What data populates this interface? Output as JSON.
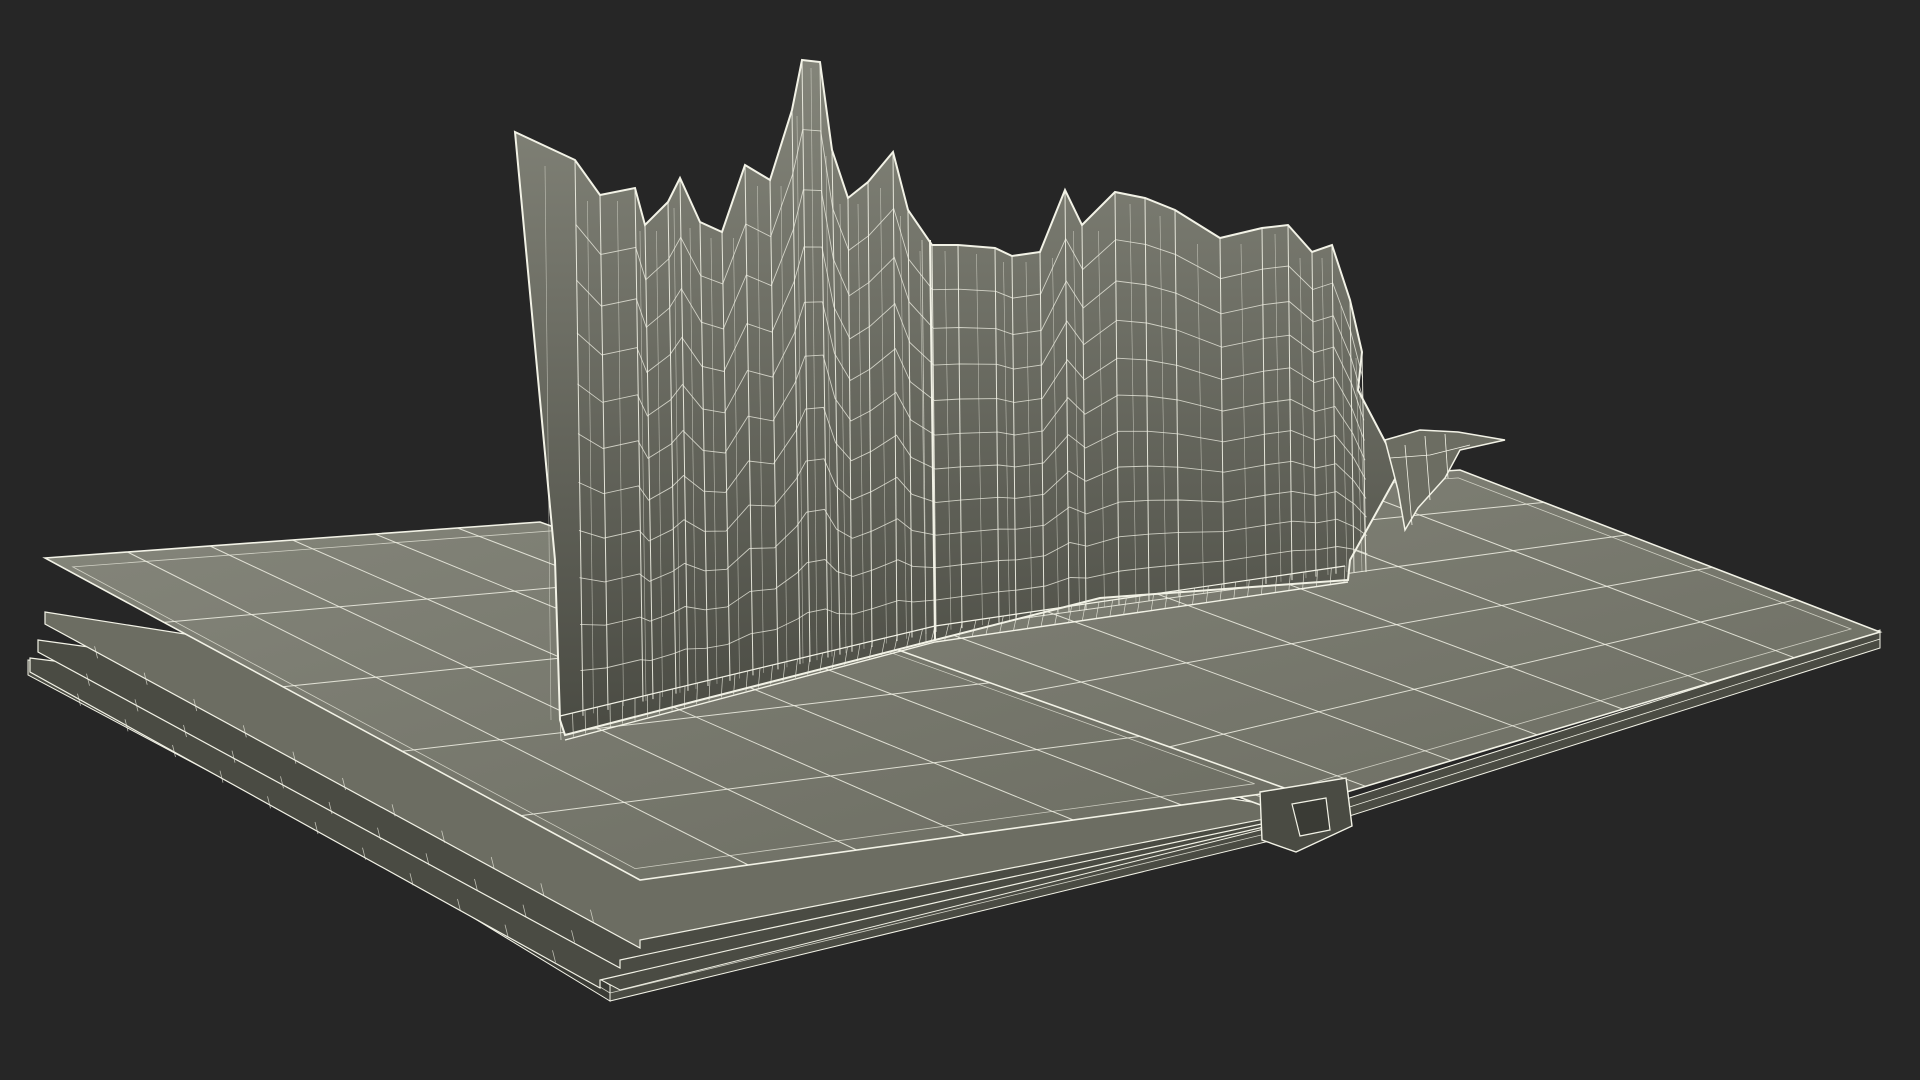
{
  "scene": {
    "subject": "wireframe-popup-book-model",
    "background_color": "#262626",
    "surface_color": "#6c6d62",
    "surface_light_color": "#84857a",
    "surface_dark_color": "#4a4b43",
    "wire_color": "#f2f2e6",
    "shadow_color": "#3a3b35"
  }
}
